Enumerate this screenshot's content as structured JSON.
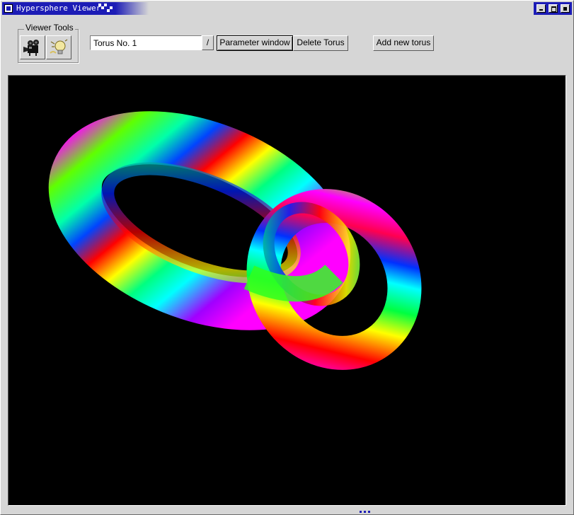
{
  "window": {
    "title": "Hypersphere Viewer",
    "title_bar_color": "#1c1cb6",
    "controls": [
      "minimize-icon",
      "maximize-icon",
      "close-icon"
    ]
  },
  "toolbar": {
    "group_label": "Viewer Tools",
    "tools": [
      {
        "name": "camera-icon"
      },
      {
        "name": "light-bulb-icon"
      }
    ],
    "torus_select": {
      "value": "Torus No. 1",
      "dropdown_glyph": "/"
    },
    "parameter_button": "Parameter window",
    "delete_button": "Delete Torus",
    "add_button": "Add new torus"
  },
  "viewport": {
    "background": "#000000",
    "content": "two linked rainbow-colored tori"
  }
}
